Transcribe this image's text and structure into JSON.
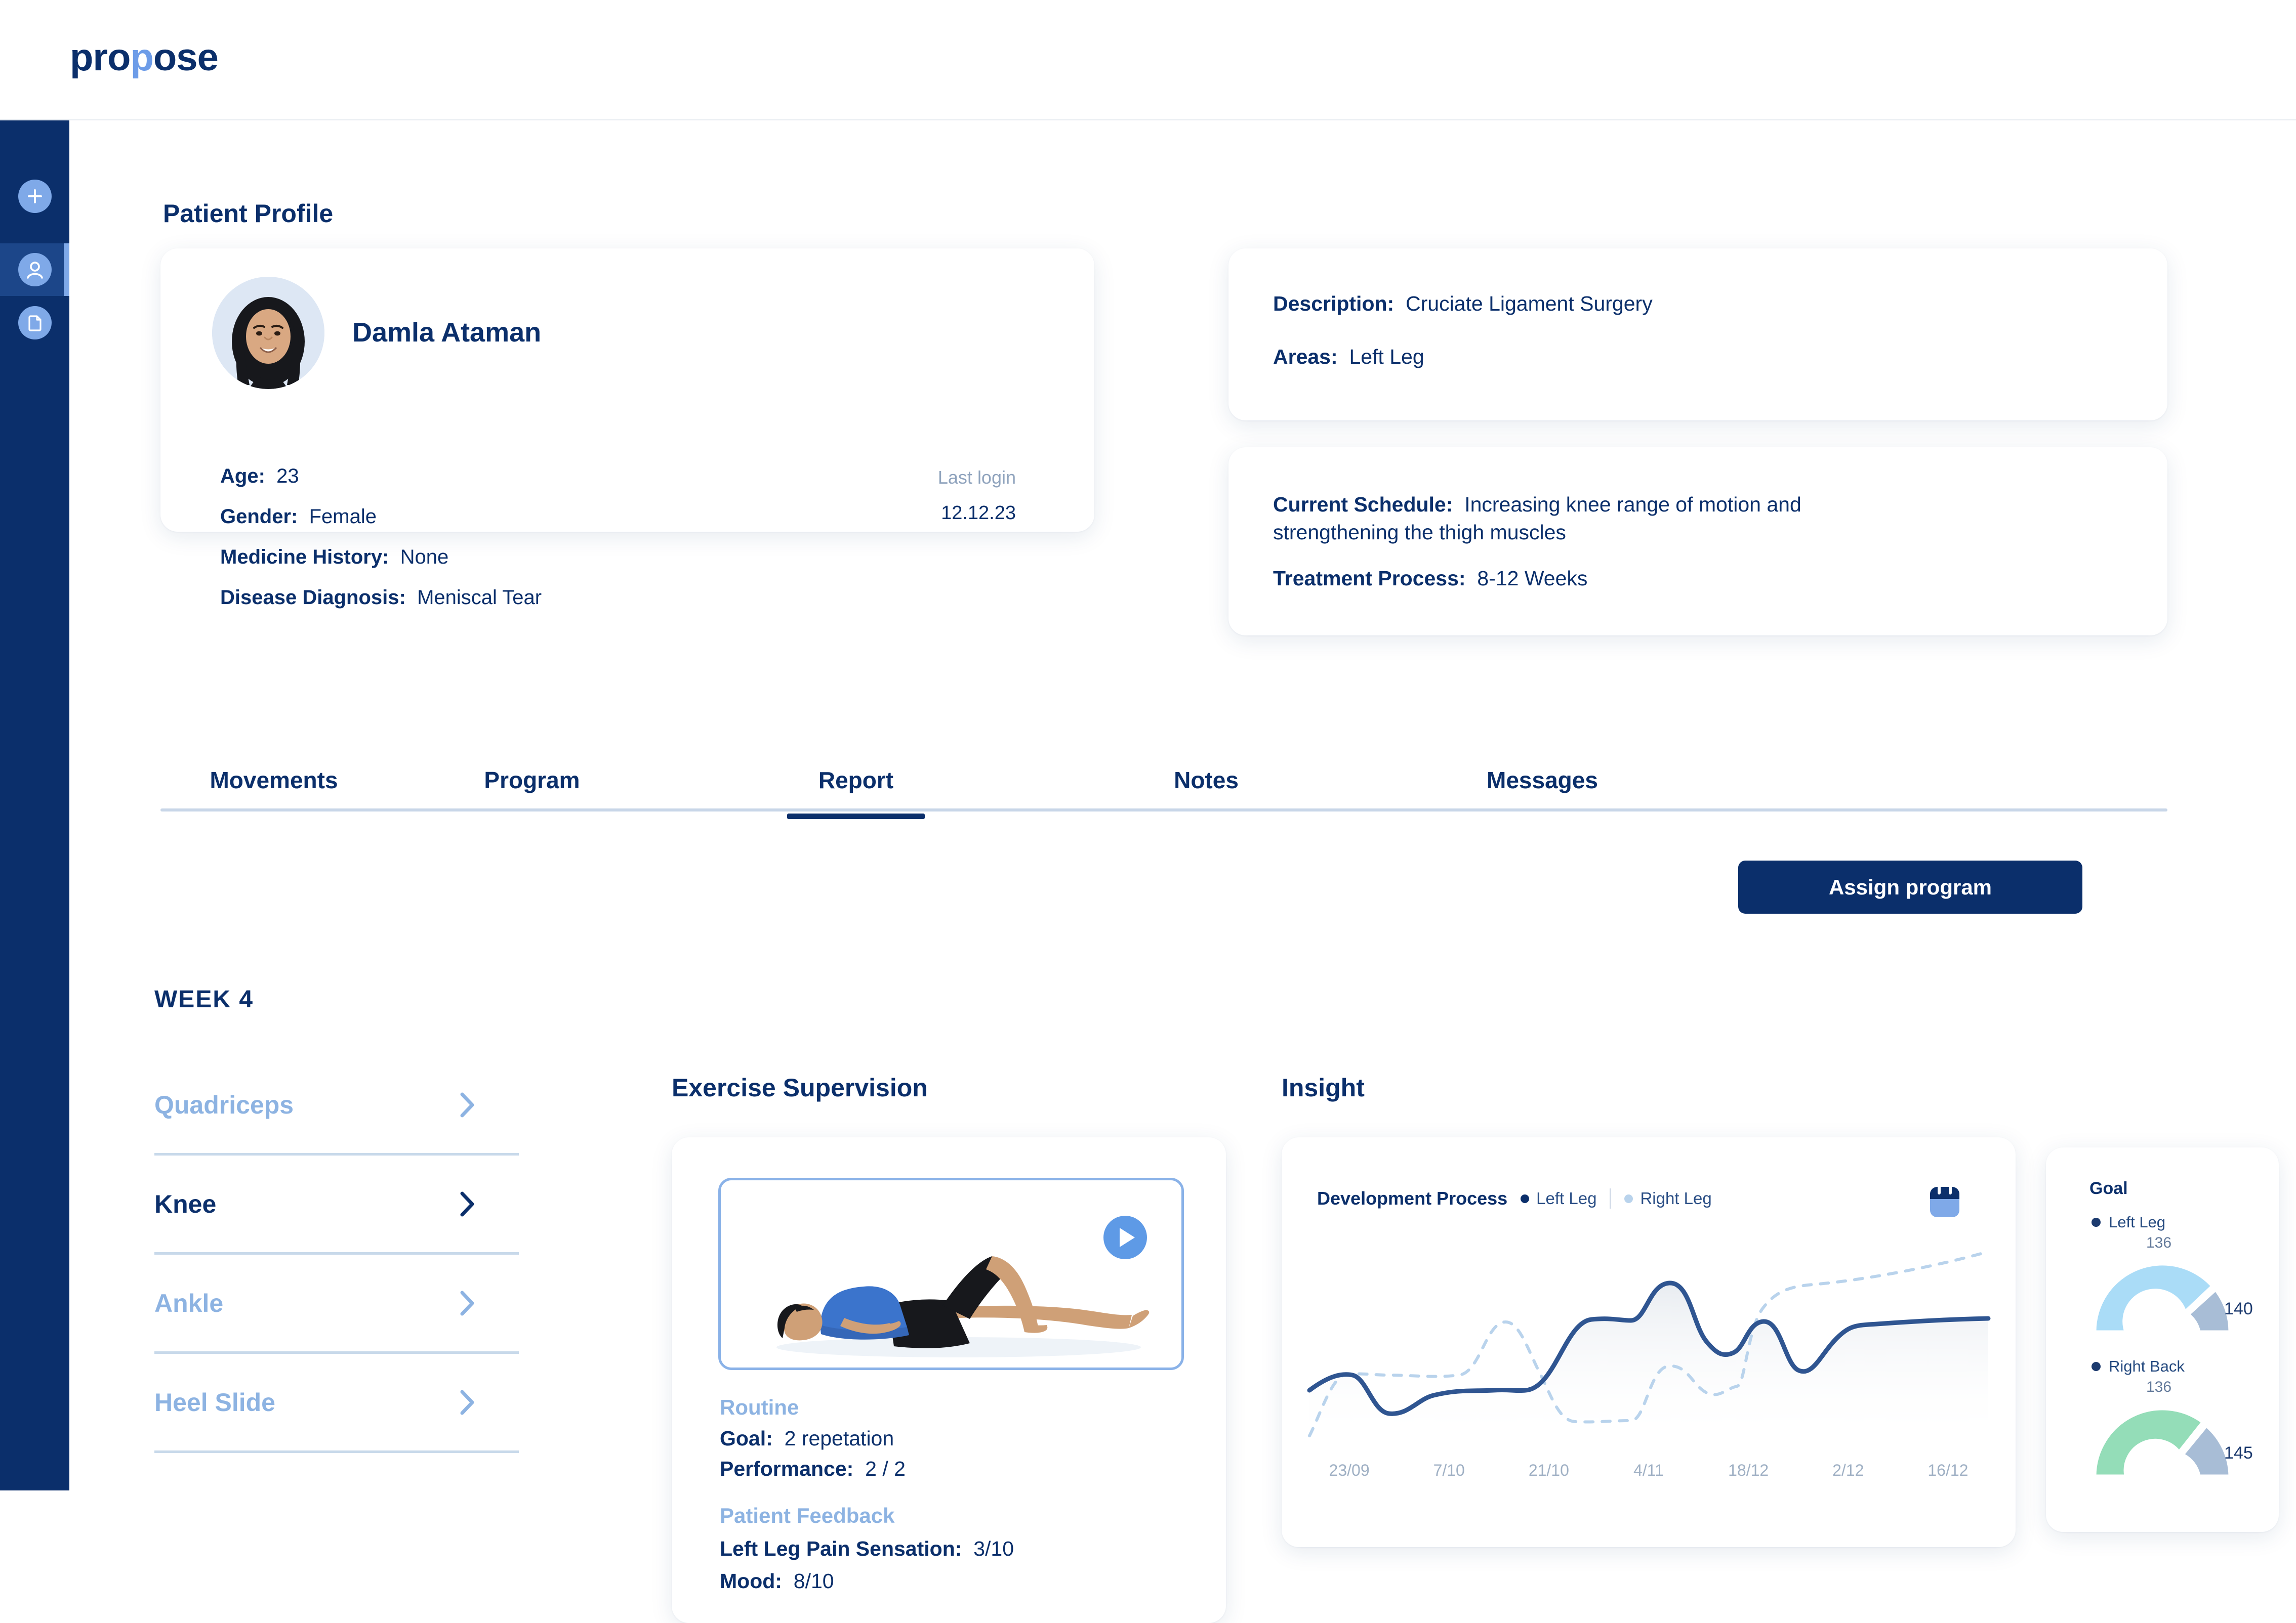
{
  "brand": {
    "name_dark1": "pro",
    "name_light": "p",
    "name_dark2": "ose"
  },
  "rail": {
    "items": [
      {
        "icon": "plus-icon",
        "active": false
      },
      {
        "icon": "user-icon",
        "active": true
      },
      {
        "icon": "document-icon",
        "active": false
      }
    ]
  },
  "profile": {
    "heading": "Patient Profile",
    "name": "Damla Ataman",
    "fields": [
      {
        "label": "Age:",
        "value": "23"
      },
      {
        "label": "Gender:",
        "value": "Female"
      },
      {
        "label": "Medicine History:",
        "value": "None"
      },
      {
        "label": "Disease Diagnosis:",
        "value": "Meniscal Tear"
      }
    ],
    "last_login_label": "Last login",
    "last_login_value": "12.12.23"
  },
  "description_card": {
    "description_label": "Description:",
    "description_value": "Cruciate Ligament Surgery",
    "areas_label": "Areas:",
    "areas_value": "Left Leg"
  },
  "schedule_card": {
    "schedule_label": "Current Schedule:",
    "schedule_value": "Increasing knee range of motion and strengthening the thigh muscles",
    "process_label": "Treatment Process:",
    "process_value": "8-12 Weeks"
  },
  "tabs": {
    "items": [
      {
        "label": "Movements",
        "active": false
      },
      {
        "label": "Program",
        "active": false
      },
      {
        "label": "Report",
        "active": true
      },
      {
        "label": "Notes",
        "active": false
      },
      {
        "label": "Messages",
        "active": false
      }
    ],
    "assign_button": "Assign program"
  },
  "week_label": "WEEK 4",
  "body_parts": [
    {
      "label": "Quadriceps",
      "selected": false
    },
    {
      "label": "Knee",
      "selected": true
    },
    {
      "label": "Ankle",
      "selected": false
    },
    {
      "label": "Heel Slide",
      "selected": false
    }
  ],
  "supervision": {
    "heading": "Exercise Supervision",
    "routine_heading": "Routine",
    "goal_label": "Goal:",
    "goal_value": "2 repetation",
    "performance_label": "Performance:",
    "performance_value": "2 / 2",
    "feedback_heading": "Patient Feedback",
    "pain_label": "Left Leg Pain Sensation:",
    "pain_value": "3/10",
    "mood_label": "Mood:",
    "mood_value": "8/10"
  },
  "insight": {
    "heading": "Insight",
    "goal_panel_title": "Goal"
  },
  "chart_data": [
    {
      "type": "line",
      "title": "Development Process",
      "xlabel": "",
      "ylabel": "",
      "grid": false,
      "legend_position": "top-left",
      "categories": [
        "23/09",
        "7/10",
        "21/10",
        "4/11",
        "18/12",
        "2/12",
        "16/12"
      ],
      "x": [
        0,
        1,
        2,
        3,
        4,
        5,
        6
      ],
      "series": [
        {
          "name": "Left Leg",
          "style": "solid",
          "color": "#2f5591",
          "values": [
            34,
            26,
            45,
            70,
            78,
            58,
            68
          ]
        },
        {
          "name": "Right Leg",
          "style": "dotted",
          "color": "#b9d3ec",
          "values": [
            12,
            42,
            30,
            25,
            40,
            72,
            86
          ]
        }
      ],
      "ylim": [
        0,
        100
      ]
    },
    {
      "type": "gauge",
      "title": "Goal",
      "gauges": [
        {
          "label": "Left Leg",
          "current": 136,
          "target": 140,
          "color": "#aadcf7",
          "remainder_color": "#a8bdd6"
        },
        {
          "label": "Right Back",
          "current": 136,
          "target": 145,
          "color": "#94ddb8",
          "remainder_color": "#a8bdd6"
        }
      ]
    }
  ]
}
